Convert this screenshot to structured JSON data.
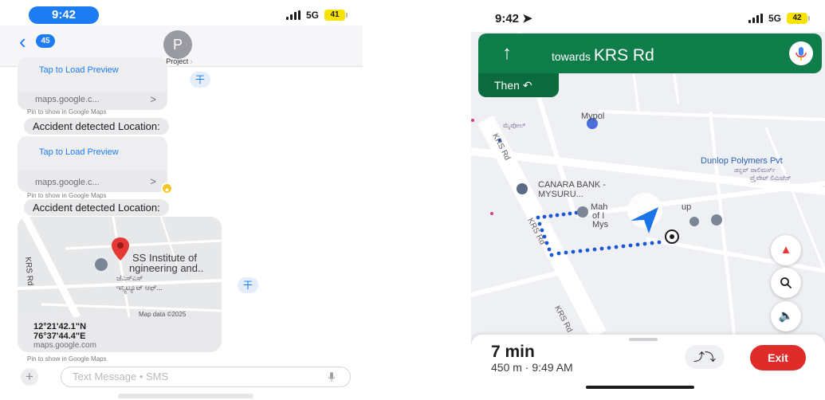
{
  "left_phone": {
    "status": {
      "time": "9:42",
      "network": "5G",
      "battery": "41"
    },
    "nav": {
      "back_count": "45",
      "avatar_initial": "P",
      "contact_name": "Project"
    },
    "link_card_1": {
      "preview": "Tap to Load Preview",
      "domain": "maps.google.c...",
      "chevron": ">"
    },
    "hint_1": "Pin to show in Google Maps",
    "message_1": "Accident detected Location:",
    "link_card_2": {
      "preview": "Tap to Load Preview",
      "domain": "maps.google.c...",
      "chevron": ">"
    },
    "hint_2": "Pin to show in Google Maps",
    "message_2": "Accident detected Location:",
    "map_card": {
      "road_label": "KRS Rd",
      "place_name_line1": "SS Institute of",
      "place_name_line2": "ngineering and..",
      "place_name_kn_line1": "ಜೆಎಸ್‌ಎಸ್",
      "place_name_kn_line2": "ಇನ್ಸ್ಟಿಟ್ಯೂಟ್ ಆಫ್...",
      "map_data": "Map data ©2025",
      "lat": "12°21'42.1\"N",
      "lon": "76°37'44.4\"E",
      "url": "maps.google.com"
    },
    "hint_3": "Pin to show in Google Maps",
    "composer": {
      "placeholder": "Text Message • SMS",
      "plus": "+"
    }
  },
  "right_phone": {
    "status": {
      "time": "9:42",
      "network": "5G",
      "battery": "42"
    },
    "nav_header": {
      "towards_prefix": "towards",
      "street": "KRS Rd",
      "then_label": "Then"
    },
    "map": {
      "poi_mypol": "Mypol",
      "poi_mypol_kn": "ಮೈಪೋಲ್",
      "poi_dunlop": "Dunlop Polymers Pvt",
      "poi_dunlop_kn_line1": "ಡನ್ಲಪ್ ಪಾಲಿಮರ್ಸ್",
      "poi_dunlop_kn_line2": "ಪ್ರೈವೇಟ್ ಲಿಮಿಟೆಡ್",
      "poi_canara_line1": "CANARA BANK -",
      "poi_canara_line2": "MYSURU...",
      "poi_maha": "Mah",
      "poi_maha_2": "up",
      "poi_mys_1": "of I",
      "poi_mys_2": "Mys",
      "road_krs_top": "KRS Rd",
      "road_krs_mid": "KRS Rd",
      "road_krs_bottom": "KRS Rd"
    },
    "eta": {
      "minutes": "7 min",
      "detail": "450 m · 9:49 AM"
    },
    "buttons": {
      "exit": "Exit"
    }
  }
}
